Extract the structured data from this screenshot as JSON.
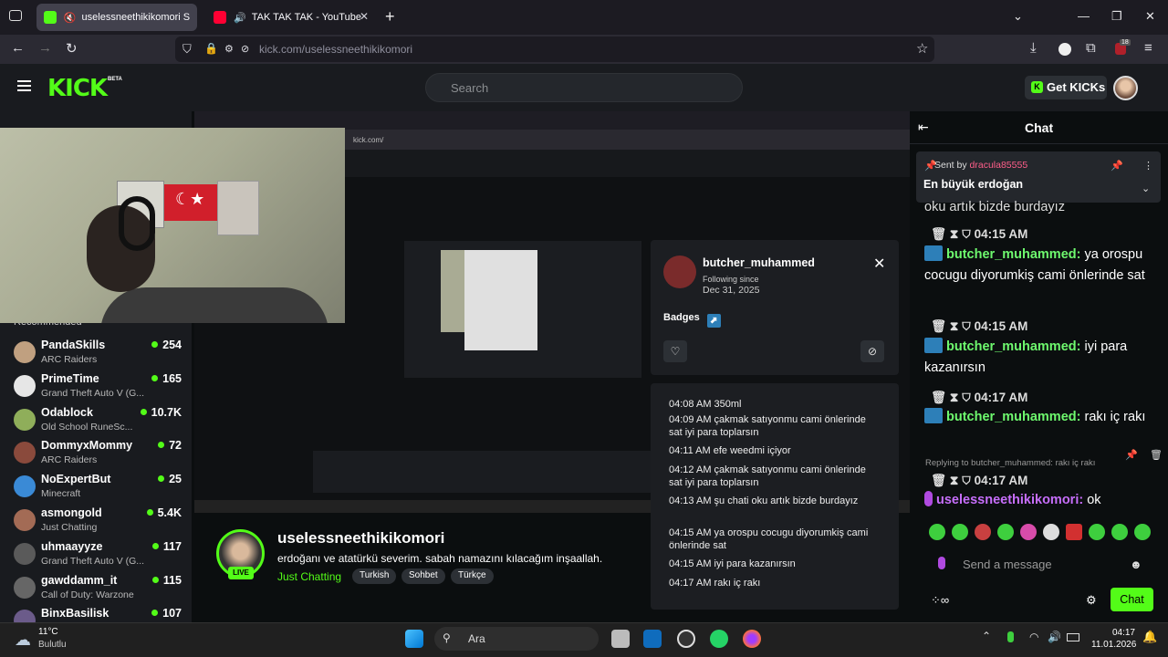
{
  "browser": {
    "tabs": [
      {
        "label": "uselessneethikikomori Strea"
      },
      {
        "label": "TAK TAK TAK - YouTube"
      }
    ],
    "new_tab": "+",
    "url_host": "kick.com/",
    "url_path": "uselessneethikikomori",
    "ext_badge": "18"
  },
  "header": {
    "logo": "KICK",
    "beta": "BETA",
    "search_placeholder": "Search",
    "get_kicks": "Get KICKs",
    "get_kicks_icon": "K"
  },
  "sidebar": {
    "recommended_title": "Recommended",
    "items": [
      {
        "name": "PandaSkills",
        "game": "ARC Raiders",
        "viewers": "254",
        "color": "#c0a080"
      },
      {
        "name": "PrimeTime",
        "game": "Grand Theft Auto V (G...",
        "viewers": "165",
        "color": "#e6e6e6"
      },
      {
        "name": "Odablock",
        "game": "Old School RuneSc...",
        "viewers": "10.7K",
        "color": "#8fae5a"
      },
      {
        "name": "DommyxMommy",
        "game": "ARC Raiders",
        "viewers": "72",
        "color": "#8a4a3c"
      },
      {
        "name": "NoExpertBut",
        "game": "Minecraft",
        "viewers": "25",
        "color": "#3a8ad6"
      },
      {
        "name": "asmongold",
        "game": "Just Chatting",
        "viewers": "5.4K",
        "color": "#a36b55"
      },
      {
        "name": "uhmaayyze",
        "game": "Grand Theft Auto V (G...",
        "viewers": "117",
        "color": "#5a5a5a"
      },
      {
        "name": "gawddamm_it",
        "game": "Call of Duty: Warzone",
        "viewers": "115",
        "color": "#666666"
      },
      {
        "name": "BinxBasilisk",
        "game": "",
        "viewers": "107",
        "color": "#6b5b8a"
      }
    ]
  },
  "user_card": {
    "username": "butcher_muhammed",
    "following_label": "Following since",
    "following_date": "Dec 31, 2025",
    "badges_label": "Badges",
    "messages": [
      "04:08 AM 350ml",
      "04:09 AM çakmak satıyonmu cami önlerinde sat iyi para toplarsın",
      "04:11 AM efe weedmi içiyor",
      "04:12 AM çakmak satıyonmu cami önlerinde sat iyi para toplarsın",
      "04:13 AM şu chati oku artık bizde burdayız",
      "04:15 AM ya orospu cocugu diyorumkiş cami önlerinde sat",
      "04:15 AM iyi para kazanırsın",
      "04:17 AM rakı iç rakı"
    ]
  },
  "channel": {
    "name": "uselessneethikikomori",
    "live": "LIVE",
    "title": "erdoğanı ve atatürkü severim. sabah namazını kılacağım inşaallah.",
    "category": "Just Chatting",
    "tags": [
      "Turkish",
      "Sohbet",
      "Türkçe"
    ]
  },
  "chat": {
    "title": "Chat",
    "pinned_prefix": "Sent by",
    "pinned_by": "dracula85555",
    "pinned_message": "En büyük erdoğan",
    "partial_top": "oku artık bizde burdayız",
    "messages": [
      {
        "time": "04:15 AM",
        "user": "butcher_muhammed:",
        "text": "ya orospu cocugu diyorumkiş cami önlerinde sat"
      },
      {
        "time": "04:15 AM",
        "user": "butcher_muhammed:",
        "text": "iyi para kazanırsın"
      },
      {
        "time": "04:17 AM",
        "user": "butcher_muhammed:",
        "text": "rakı iç rakı"
      },
      {
        "time": "04:17 AM",
        "user": "uselessneethikikomori:",
        "text": "ok"
      }
    ],
    "reply_text": "Replying to butcher_muhammed: rakı iç rakı",
    "input_placeholder": "Send a message",
    "send_label": "Chat"
  },
  "taskbar": {
    "temp": "11°C",
    "weather": "Bulutlu",
    "search": "Ara",
    "time": "04:17",
    "date": "11.01.2026"
  }
}
